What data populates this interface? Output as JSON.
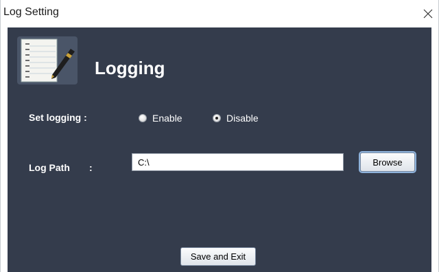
{
  "window": {
    "title": "Log Setting",
    "close_glyph": "✕"
  },
  "header": {
    "icon": "notebook-pen-icon",
    "title": "Logging"
  },
  "logging": {
    "label": "Set logging :",
    "options": [
      {
        "label": "Enable",
        "selected": false
      },
      {
        "label": "Disable",
        "selected": true
      }
    ]
  },
  "log_path": {
    "label": "Log Path",
    "colon": ":",
    "value": "C:\\",
    "browse_label": "Browse"
  },
  "footer": {
    "save_label": "Save and Exit"
  },
  "colors": {
    "panel": "#343c4c",
    "text": "#ffffff",
    "button_focus": "#8fb4dd"
  }
}
